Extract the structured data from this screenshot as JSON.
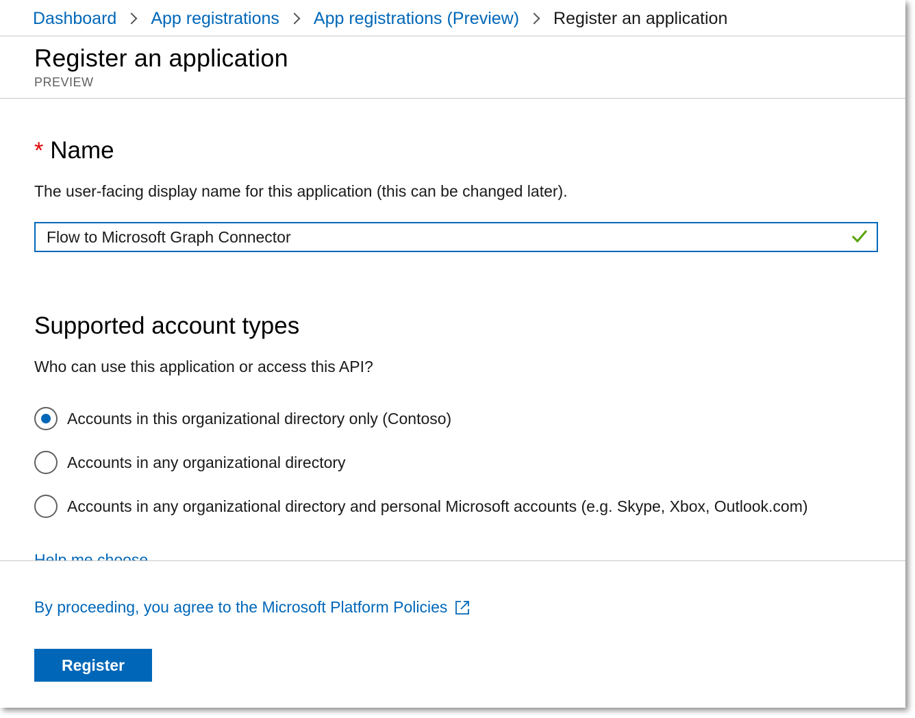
{
  "breadcrumb": {
    "items": [
      {
        "label": "Dashboard"
      },
      {
        "label": "App registrations"
      },
      {
        "label": "App registrations (Preview)"
      }
    ],
    "current": "Register an application"
  },
  "header": {
    "title": "Register an application",
    "subtitle": "PREVIEW"
  },
  "name_section": {
    "required_marker": "*",
    "heading": "Name",
    "description": "The user-facing display name for this application (this can be changed later).",
    "input_value": "Flow to Microsoft Graph Connector",
    "valid": true
  },
  "account_section": {
    "heading": "Supported account types",
    "question": "Who can use this application or access this API?",
    "options": [
      {
        "label": "Accounts in this organizational directory only (Contoso)",
        "selected": true
      },
      {
        "label": "Accounts in any organizational directory",
        "selected": false
      },
      {
        "label": "Accounts in any organizational directory and personal Microsoft accounts (e.g. Skype, Xbox, Outlook.com)",
        "selected": false
      }
    ],
    "help_link": "Help me choose..."
  },
  "footer": {
    "policy_text": "By proceeding, you agree to the Microsoft Platform Policies",
    "register_label": "Register"
  },
  "colors": {
    "accent": "#0067b8",
    "required": "#e00000",
    "valid_check": "#57a300"
  },
  "icons": {
    "breadcrumb_separator": "chevron-right-icon",
    "valid": "checkmark-icon",
    "external_link": "external-link-icon"
  }
}
